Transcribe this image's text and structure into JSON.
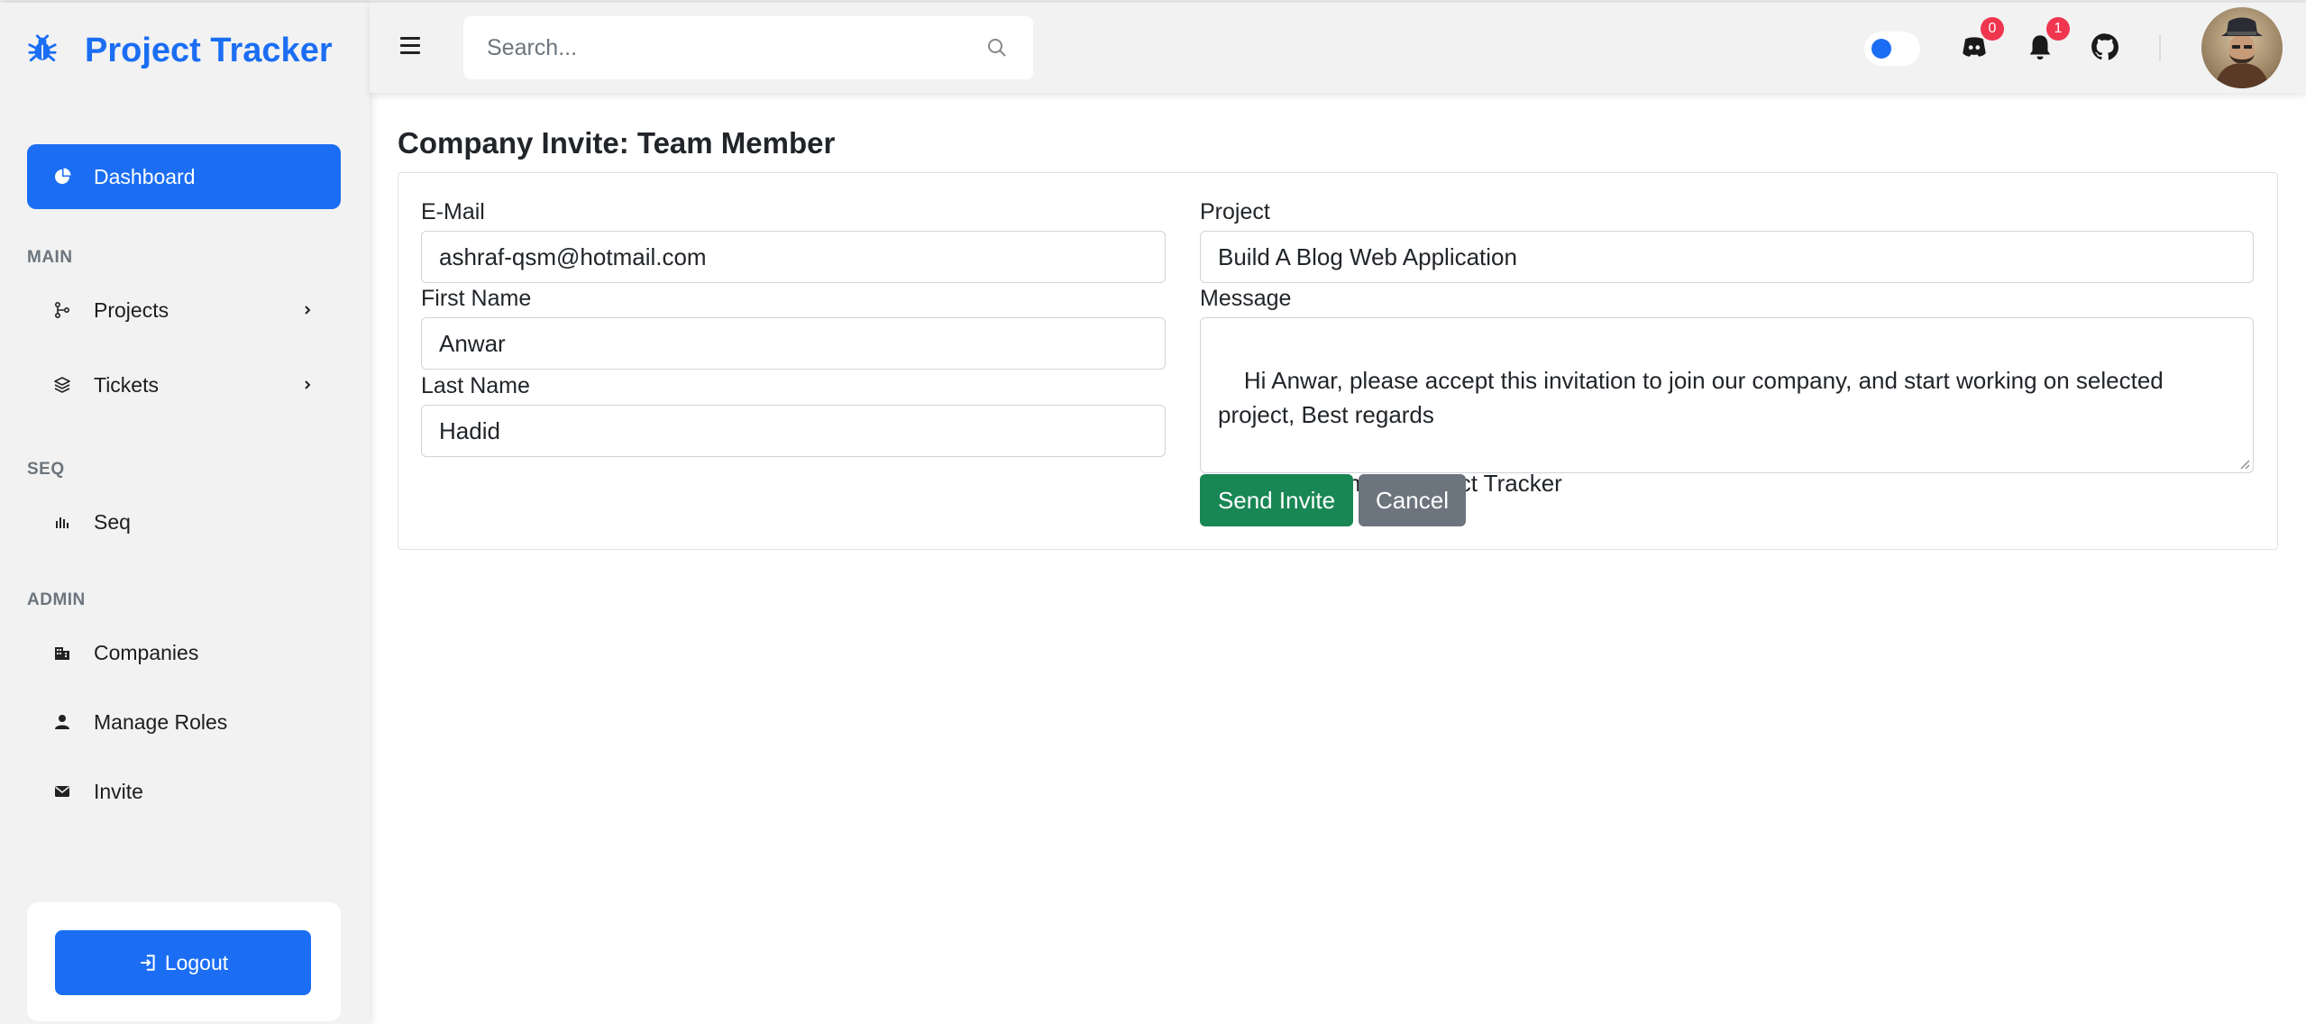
{
  "app": {
    "title": "Project Tracker"
  },
  "sidebar": {
    "dashboard": "Dashboard",
    "sections": {
      "main": "MAIN",
      "seq": "SEQ",
      "admin": "ADMIN"
    },
    "items": {
      "projects": "Projects",
      "tickets": "Tickets",
      "seq": "Seq",
      "companies": "Companies",
      "manage_roles": "Manage Roles",
      "invite": "Invite"
    },
    "logout": "Logout"
  },
  "topbar": {
    "search_placeholder": "Search...",
    "messages_count": "0",
    "notifications_count": "1"
  },
  "page": {
    "title": "Company Invite: Team Member",
    "form": {
      "email_label": "E-Mail",
      "email_value": "ashraf-qsm@hotmail.com",
      "first_name_label": "First Name",
      "first_name_value": "Anwar",
      "last_name_label": "Last Name",
      "last_name_value": "Hadid",
      "project_label": "Project",
      "project_value": "Build A Blog Web Application",
      "message_label": "Message",
      "message_value": "Hi Anwar, please accept this invitation to join our company, and start working on selected\nproject, Best regards\n\nAshraf Qasem @ Project Tracker",
      "send_label": "Send Invite",
      "cancel_label": "Cancel"
    }
  },
  "colors": {
    "primary": "#1b6ef3",
    "success": "#198754",
    "secondary": "#6c757d",
    "badge": "#f0354f",
    "sidebar_bg": "#f2f2f2"
  },
  "icons": {
    "brand": "bug-icon",
    "dashboard": "pie-chart-icon",
    "projects": "git-branch-icon",
    "tickets": "layers-icon",
    "seq": "bar-chart-icon",
    "companies": "building-icon",
    "manage_roles": "user-icon",
    "invite": "envelope-icon",
    "logout": "logout-icon",
    "menu": "hamburger-icon",
    "search": "search-icon",
    "messages": "discord-icon",
    "notifications": "bell-icon",
    "github": "github-icon"
  }
}
